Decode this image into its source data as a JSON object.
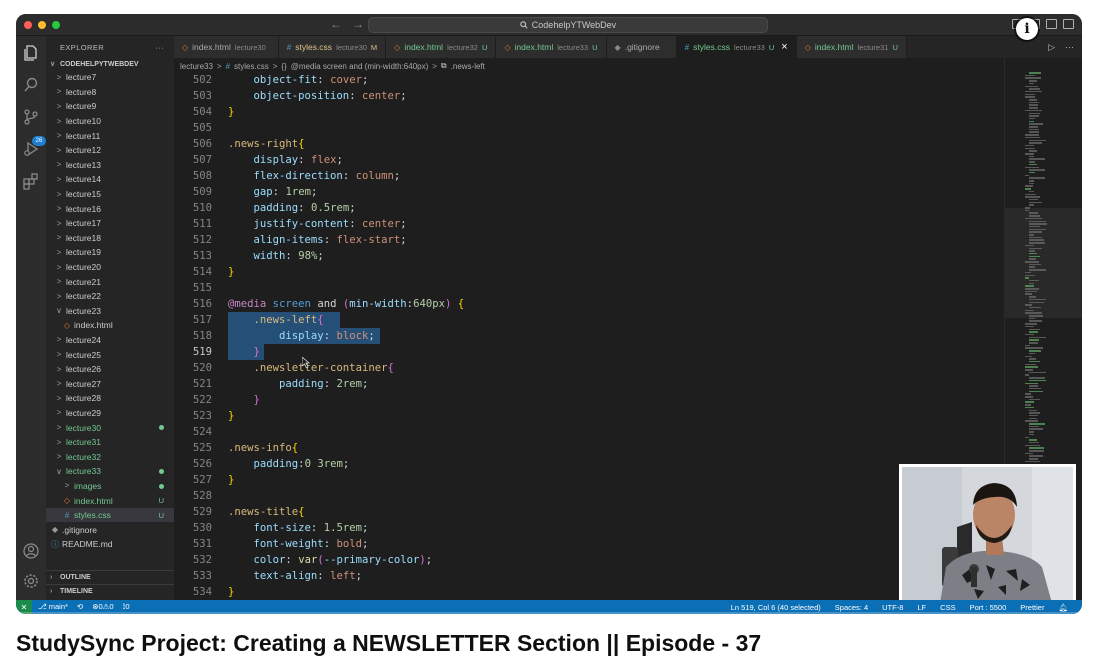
{
  "video_title": "StudySync Project: Creating a NEWSLETTER Section || Episode - 37",
  "window": {
    "command_center": "CodehelpYTWebDev",
    "nav_back": "←",
    "nav_forward": "→"
  },
  "explorer": {
    "title": "EXPLORER",
    "more": "···",
    "root_folder": "CODEHELPYTWEBDEV",
    "items": [
      {
        "label": "lecture7",
        "chev": ">"
      },
      {
        "label": "lecture8",
        "chev": ">"
      },
      {
        "label": "lecture9",
        "chev": ">"
      },
      {
        "label": "lecture10",
        "chev": ">"
      },
      {
        "label": "lecture11",
        "chev": ">"
      },
      {
        "label": "lecture12",
        "chev": ">"
      },
      {
        "label": "lecture13",
        "chev": ">"
      },
      {
        "label": "lecture14",
        "chev": ">"
      },
      {
        "label": "lecture15",
        "chev": ">"
      },
      {
        "label": "lecture16",
        "chev": ">"
      },
      {
        "label": "lecture17",
        "chev": ">"
      },
      {
        "label": "lecture18",
        "chev": ">"
      },
      {
        "label": "lecture19",
        "chev": ">"
      },
      {
        "label": "lecture20",
        "chev": ">"
      },
      {
        "label": "lecture21",
        "chev": ">"
      },
      {
        "label": "lecture22",
        "chev": ">"
      },
      {
        "label": "lecture23",
        "chev": "∨"
      },
      {
        "label": "index.html",
        "chev": "◇"
      },
      {
        "label": "lecture24",
        "chev": ">"
      },
      {
        "label": "lecture25",
        "chev": ">"
      },
      {
        "label": "lecture26",
        "chev": ">"
      },
      {
        "label": "lecture27",
        "chev": ">"
      },
      {
        "label": "lecture28",
        "chev": ">"
      },
      {
        "label": "lecture29",
        "chev": ">"
      },
      {
        "label": "lecture30",
        "chev": ">"
      },
      {
        "label": "lecture31",
        "chev": ">"
      },
      {
        "label": "lecture32",
        "chev": ">"
      },
      {
        "label": "lecture33",
        "chev": "∨"
      },
      {
        "label": "images",
        "chev": ">"
      },
      {
        "label": "index.html",
        "chev": "◇",
        "badge": "U"
      },
      {
        "label": "styles.css",
        "chev": "#",
        "badge": "U"
      },
      {
        "label": ".gitignore",
        "chev": "◆"
      },
      {
        "label": "README.md",
        "chev": "ⓘ"
      }
    ],
    "outline": "OUTLINE",
    "timeline": "TIMELINE"
  },
  "activity": {
    "scm_badge": "26"
  },
  "tabs": [
    {
      "icon": "◇",
      "name": "index.html",
      "sub": "lecture30",
      "flag": ""
    },
    {
      "icon": "#",
      "name": "styles.css",
      "sub": "lecture30",
      "flag": "M"
    },
    {
      "icon": "◇",
      "name": "index.html",
      "sub": "lecture32",
      "flag": "U"
    },
    {
      "icon": "◇",
      "name": "index.html",
      "sub": "lecture33",
      "flag": "U"
    },
    {
      "icon": "◆",
      "name": ".gitignore",
      "sub": "",
      "flag": ""
    },
    {
      "icon": "#",
      "name": "styles.css",
      "sub": "lecture33",
      "flag": "U"
    },
    {
      "icon": "◇",
      "name": "index.html",
      "sub": "lecture31",
      "flag": "U"
    }
  ],
  "tab_close": "×",
  "breadcrumb": {
    "folder": "lecture33",
    "file": "styles.css",
    "scope": "@media screen and (min-width:640px)",
    "symbol": ".news-left",
    "sep": ">"
  },
  "editor": {
    "current_line": "519",
    "lines": [
      {
        "n": "502",
        "code": "    object-fit: cover;"
      },
      {
        "n": "503",
        "code": "    object-position: center;"
      },
      {
        "n": "504",
        "code": "}"
      },
      {
        "n": "505",
        "code": ""
      },
      {
        "n": "506",
        "code": ".news-right{"
      },
      {
        "n": "507",
        "code": "    display: flex;"
      },
      {
        "n": "508",
        "code": "    flex-direction: column;"
      },
      {
        "n": "509",
        "code": "    gap: 1rem;"
      },
      {
        "n": "510",
        "code": "    padding: 0.5rem;"
      },
      {
        "n": "511",
        "code": "    justify-content: center;"
      },
      {
        "n": "512",
        "code": "    align-items: flex-start;"
      },
      {
        "n": "513",
        "code": "    width: 98%;"
      },
      {
        "n": "514",
        "code": "}"
      },
      {
        "n": "515",
        "code": ""
      },
      {
        "n": "516",
        "code": "@media screen and (min-width:640px) {"
      },
      {
        "n": "517",
        "code": "    .news-left{"
      },
      {
        "n": "518",
        "code": "        display: block;"
      },
      {
        "n": "519",
        "code": "    }"
      },
      {
        "n": "520",
        "code": "    .newsletter-container{"
      },
      {
        "n": "521",
        "code": "        padding: 2rem;"
      },
      {
        "n": "522",
        "code": "    }"
      },
      {
        "n": "523",
        "code": "}"
      },
      {
        "n": "524",
        "code": ""
      },
      {
        "n": "525",
        "code": ".news-info{"
      },
      {
        "n": "526",
        "code": "    padding:0 3rem;"
      },
      {
        "n": "527",
        "code": "}"
      },
      {
        "n": "528",
        "code": ""
      },
      {
        "n": "529",
        "code": ".news-title{"
      },
      {
        "n": "530",
        "code": "    font-size: 1.5rem;"
      },
      {
        "n": "531",
        "code": "    font-weight: bold;"
      },
      {
        "n": "532",
        "code": "    color: var(--primary-color);"
      },
      {
        "n": "533",
        "code": "    text-align: left;"
      },
      {
        "n": "534",
        "code": "}"
      }
    ]
  },
  "statusbar": {
    "branch": "main*",
    "sync": "⟲",
    "problems": "⊗0⚠0",
    "ports": "⟟0",
    "position": "Ln 519, Col 6 (40 selected)",
    "spaces": "Spaces: 4",
    "encoding": "UTF-8",
    "eol": "LF",
    "language": "CSS",
    "port": "Port : 5500",
    "prettier": "Prettier"
  },
  "info_button": "i",
  "colors": {
    "statusbar": "#0a6fb5",
    "selection": "#264f78",
    "git_added": "#73c991",
    "progress": "#ff0000"
  },
  "icons": {
    "explorer": "files-icon",
    "search": "search-icon",
    "scm": "source-control-icon",
    "run": "run-debug-icon",
    "extensions": "extensions-icon",
    "account": "account-icon",
    "settings": "gear-icon"
  }
}
